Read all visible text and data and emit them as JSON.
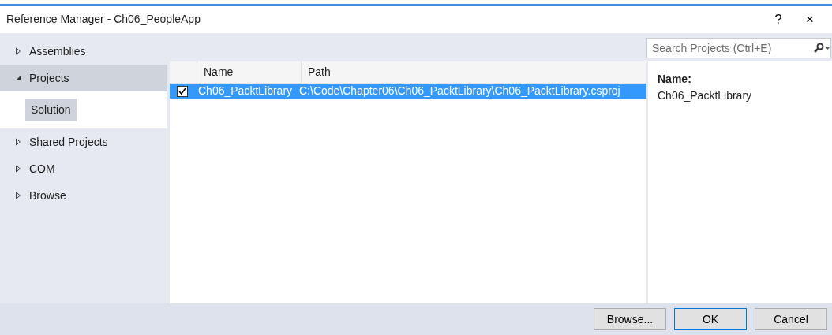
{
  "window": {
    "title": "Reference Manager - Ch06_PeopleApp",
    "help": "?",
    "close": "×"
  },
  "sidebar": {
    "items": [
      {
        "label": "Assemblies",
        "expanded": false,
        "selected": false
      },
      {
        "label": "Projects",
        "expanded": true,
        "selected": true,
        "children": [
          {
            "label": "Solution",
            "selected": true
          }
        ]
      },
      {
        "label": "Shared Projects",
        "expanded": false,
        "selected": false
      },
      {
        "label": "COM",
        "expanded": false,
        "selected": false
      },
      {
        "label": "Browse",
        "expanded": false,
        "selected": false
      }
    ]
  },
  "search": {
    "placeholder": "Search Projects (Ctrl+E)"
  },
  "table": {
    "columns": [
      "Name",
      "Path"
    ],
    "rows": [
      {
        "checked": true,
        "selected": true,
        "cells": [
          "Ch06_PacktLibrary",
          "C:\\Code\\Chapter06\\Ch06_PacktLibrary\\Ch06_PacktLibrary.csproj"
        ]
      }
    ]
  },
  "details": {
    "label": "Name:",
    "value": "Ch06_PacktLibrary"
  },
  "buttons": [
    {
      "label": "Browse...",
      "default": false
    },
    {
      "label": "OK",
      "default": true
    },
    {
      "label": "Cancel",
      "default": false
    }
  ]
}
